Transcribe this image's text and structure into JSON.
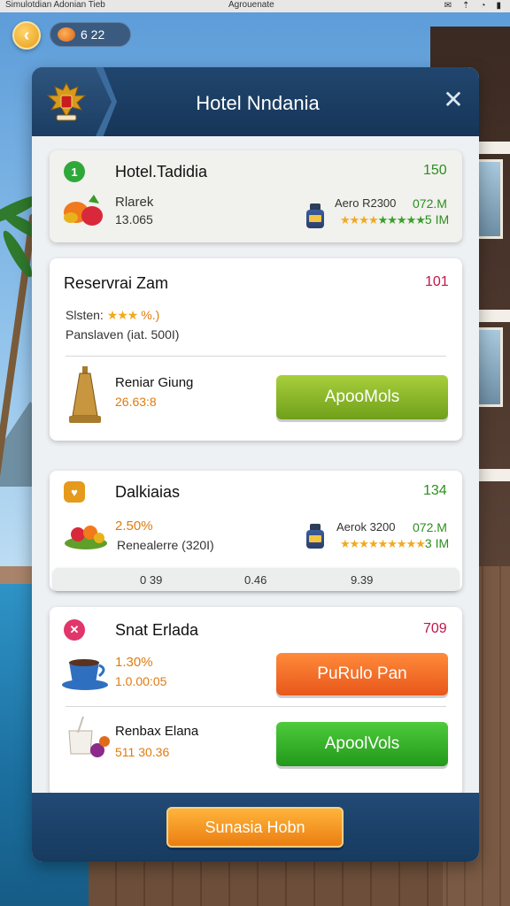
{
  "status_bar": {
    "left_text": "Simulotdian Adonian Tieb",
    "center_text": "Agrouenate",
    "icons": [
      "mail-icon",
      "signal-icon",
      "wifi-icon",
      "battery-icon"
    ]
  },
  "top_bar": {
    "back_icon": "chevron-left-icon",
    "currency_value": "6 22"
  },
  "dialog": {
    "title": "Hotel Nndania",
    "close_icon": "close-icon"
  },
  "cards": {
    "hotel": {
      "badge": "1",
      "title": "Hotel.Tadidia",
      "value": "150",
      "item_name": "Rlarek",
      "item_value": "13.065",
      "right_label": "Aero R2300",
      "right_value": "072.M",
      "rating_suffix": "5 IM"
    },
    "reservation": {
      "title": "Reservrai Zam",
      "value": "101",
      "status_label": "Slsten:",
      "status_suffix": "%.)",
      "sub_line": "Panslaven (iat. 500I)",
      "item_name": "Reniar Giung",
      "item_value": "26.63:8",
      "button": "ApooMols"
    },
    "dalkiaias": {
      "title": "Dalkiaias",
      "value": "134",
      "percent": "2.50%",
      "item_name": "Renealerre (320I)",
      "right_label": "Aerok 3200",
      "right_value": "072.M",
      "rating_suffix": "3 IM",
      "stats": [
        "0 39",
        "0.46",
        "9.39"
      ]
    },
    "snat": {
      "title": "Snat Erlada",
      "value": "709",
      "percent": "1.30%",
      "time": "1.0.00:05",
      "button_primary": "PuRulo Pan",
      "item_name": "Renbax Elana",
      "item_value": "511 30.36",
      "button_secondary": "ApoolVols"
    }
  },
  "footer": {
    "button": "Sunasia Hobn"
  },
  "colors": {
    "header_blue": "#1b3d63",
    "accent_green": "#2c8f1f",
    "accent_crimson": "#c0174a",
    "accent_orange": "#e07b0e",
    "button_olive": "#8bb52a",
    "button_green": "#33b22a",
    "button_orange": "#f26b24",
    "button_gold": "#f39a1f"
  }
}
